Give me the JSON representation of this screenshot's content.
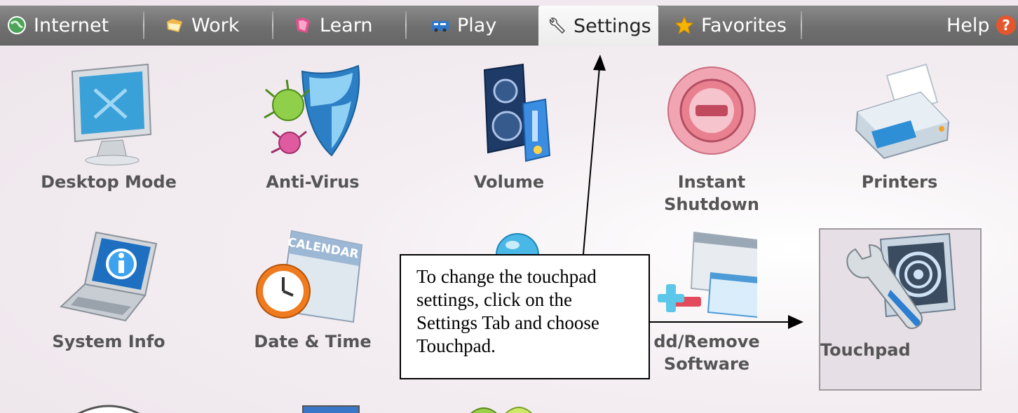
{
  "tabs": [
    {
      "label": "Internet",
      "icon": "globe-icon"
    },
    {
      "label": "Work",
      "icon": "folder-icon"
    },
    {
      "label": "Learn",
      "icon": "book-icon"
    },
    {
      "label": "Play",
      "icon": "game-icon"
    },
    {
      "label": "Settings",
      "icon": "wrench-icon",
      "active": true
    },
    {
      "label": "Favorites",
      "icon": "star-icon"
    }
  ],
  "help": {
    "label": "Help",
    "icon": "question-icon"
  },
  "items": {
    "desktop_mode": {
      "line1": "Desktop Mode"
    },
    "anti_virus": {
      "line1": "Anti-Virus"
    },
    "volume": {
      "line1": "Volume"
    },
    "instant_shutdown": {
      "line1": "Instant",
      "line2": "Shutdown"
    },
    "printers": {
      "line1": "Printers"
    },
    "system_info": {
      "line1": "System Info"
    },
    "date_time": {
      "line1": "Date & Time"
    },
    "add_remove": {
      "line1": "dd/Remove",
      "line2": "Software"
    },
    "touchpad": {
      "line1": "Touchpad"
    }
  },
  "callout": {
    "lines": [
      "To change the touchpad",
      "settings, click on the",
      "Settings Tab and choose",
      "Touchpad."
    ]
  },
  "colors": {
    "tabbar": "#6f6f6f",
    "active_tab": "#f2f2f2",
    "help_icon": "#e4572e",
    "favorites_star": "#f5b400"
  }
}
